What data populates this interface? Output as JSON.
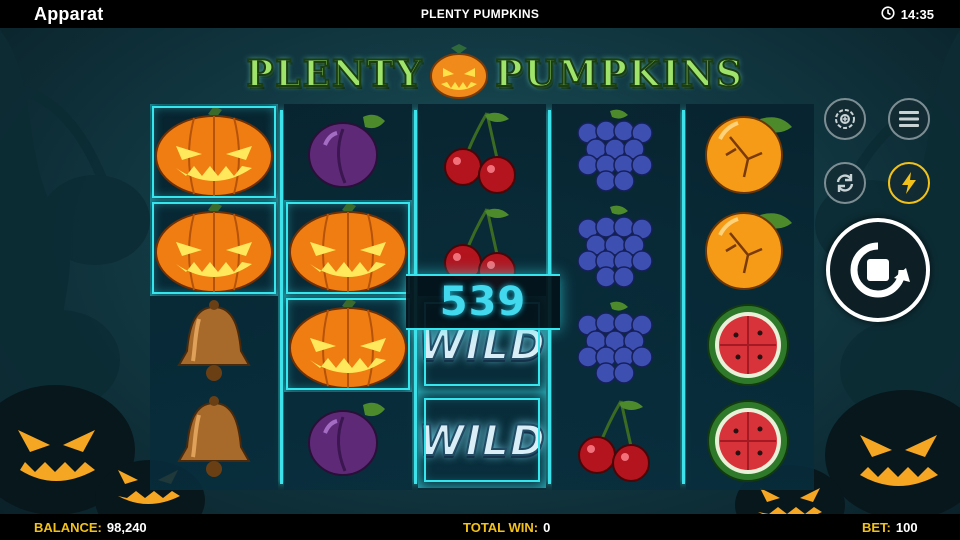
{
  "header": {
    "brand": "Apparat",
    "title": "PLENTY PUMPKINS",
    "time": "14:35"
  },
  "logo": {
    "word1": "PLENTY",
    "word2": "PUMPKINS"
  },
  "reels": [
    [
      "pumpkin",
      "pumpkin",
      "bell",
      "bell"
    ],
    [
      "plum",
      "pumpkin",
      "pumpkin",
      "plum"
    ],
    [
      "cherry",
      "cherry",
      "wild",
      "wild"
    ],
    [
      "grapes",
      "grapes",
      "grapes",
      "cherry"
    ],
    [
      "orange",
      "orange",
      "watermelon",
      "watermelon"
    ]
  ],
  "wild_label": "WILD",
  "win_amount": "539",
  "footer": {
    "balance_label": "BALANCE:",
    "balance_value": "98,240",
    "total_win_label": "TOTAL WIN:",
    "total_win_value": "0",
    "bet_label": "BET:",
    "bet_value": "100"
  },
  "colors": {
    "accent": "#36e6ee",
    "label_yellow": "#f2c21a",
    "background": "#123a44"
  },
  "icons": {
    "clock": "clock-icon",
    "autoplay": "autoplay-icon",
    "menu": "menu-icon",
    "refresh": "refresh-icon",
    "turbo": "lightning-icon",
    "spin": "spin-icon"
  }
}
